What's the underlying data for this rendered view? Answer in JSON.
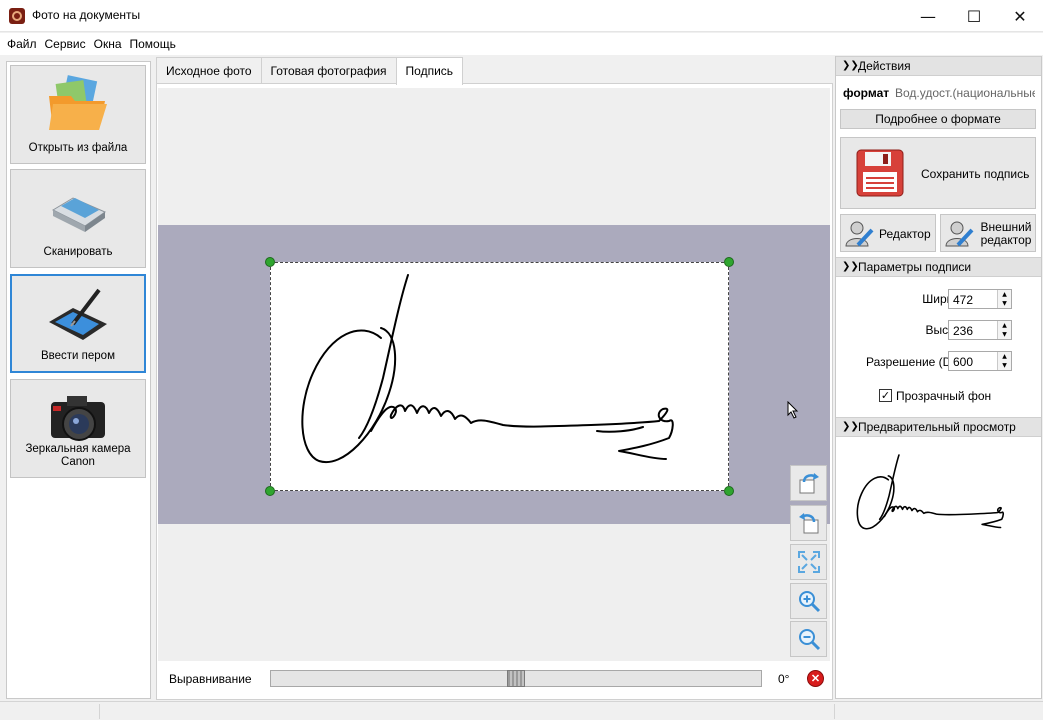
{
  "window": {
    "title": "Фото на документы",
    "minimize": "—",
    "maximize": "☐",
    "close": "✕"
  },
  "menu": [
    "Файл",
    "Сервис",
    "Окна",
    "Помощь"
  ],
  "left_buttons": [
    {
      "label": "Открыть из файла",
      "icon": "folder-photos-icon"
    },
    {
      "label": "Сканировать",
      "icon": "scanner-icon"
    },
    {
      "label": "Ввести пером",
      "icon": "pen-tablet-icon",
      "active": true
    },
    {
      "label": "Зеркальная камера Canon",
      "icon": "camera-icon"
    }
  ],
  "tabs": [
    {
      "label": "Исходное фото"
    },
    {
      "label": "Готовая фотография"
    },
    {
      "label": "Подпись",
      "active": true
    }
  ],
  "alignment": {
    "label": "Выравнивание",
    "value": "0°",
    "slider_fraction": 0.5
  },
  "actions": {
    "header": "Действия",
    "format_label": "формат",
    "format_value": "Вод.удост.(национальные,",
    "more_button": "Подробнее о формате",
    "save_button": "Сохранить подпись",
    "editor_button": "Редактор",
    "external_editor_button": "Внешний редактор",
    "external_editor_line1": "Внешний",
    "external_editor_line2": "редактор"
  },
  "params": {
    "header": "Параметры подписи",
    "width_label": "Ширина:",
    "width_value": "472",
    "height_label": "Высота:",
    "height_value": "236",
    "dpi_label": "Разрешение (DPI):",
    "dpi_value": "600",
    "transparent_label": "Прозрачный фон",
    "transparent_checked": true
  },
  "preview": {
    "header": "Предварительный просмотр"
  },
  "colors": {
    "accent": "#2f86d6",
    "signature_band": "#abaabd",
    "handle": "#2fa52f"
  }
}
